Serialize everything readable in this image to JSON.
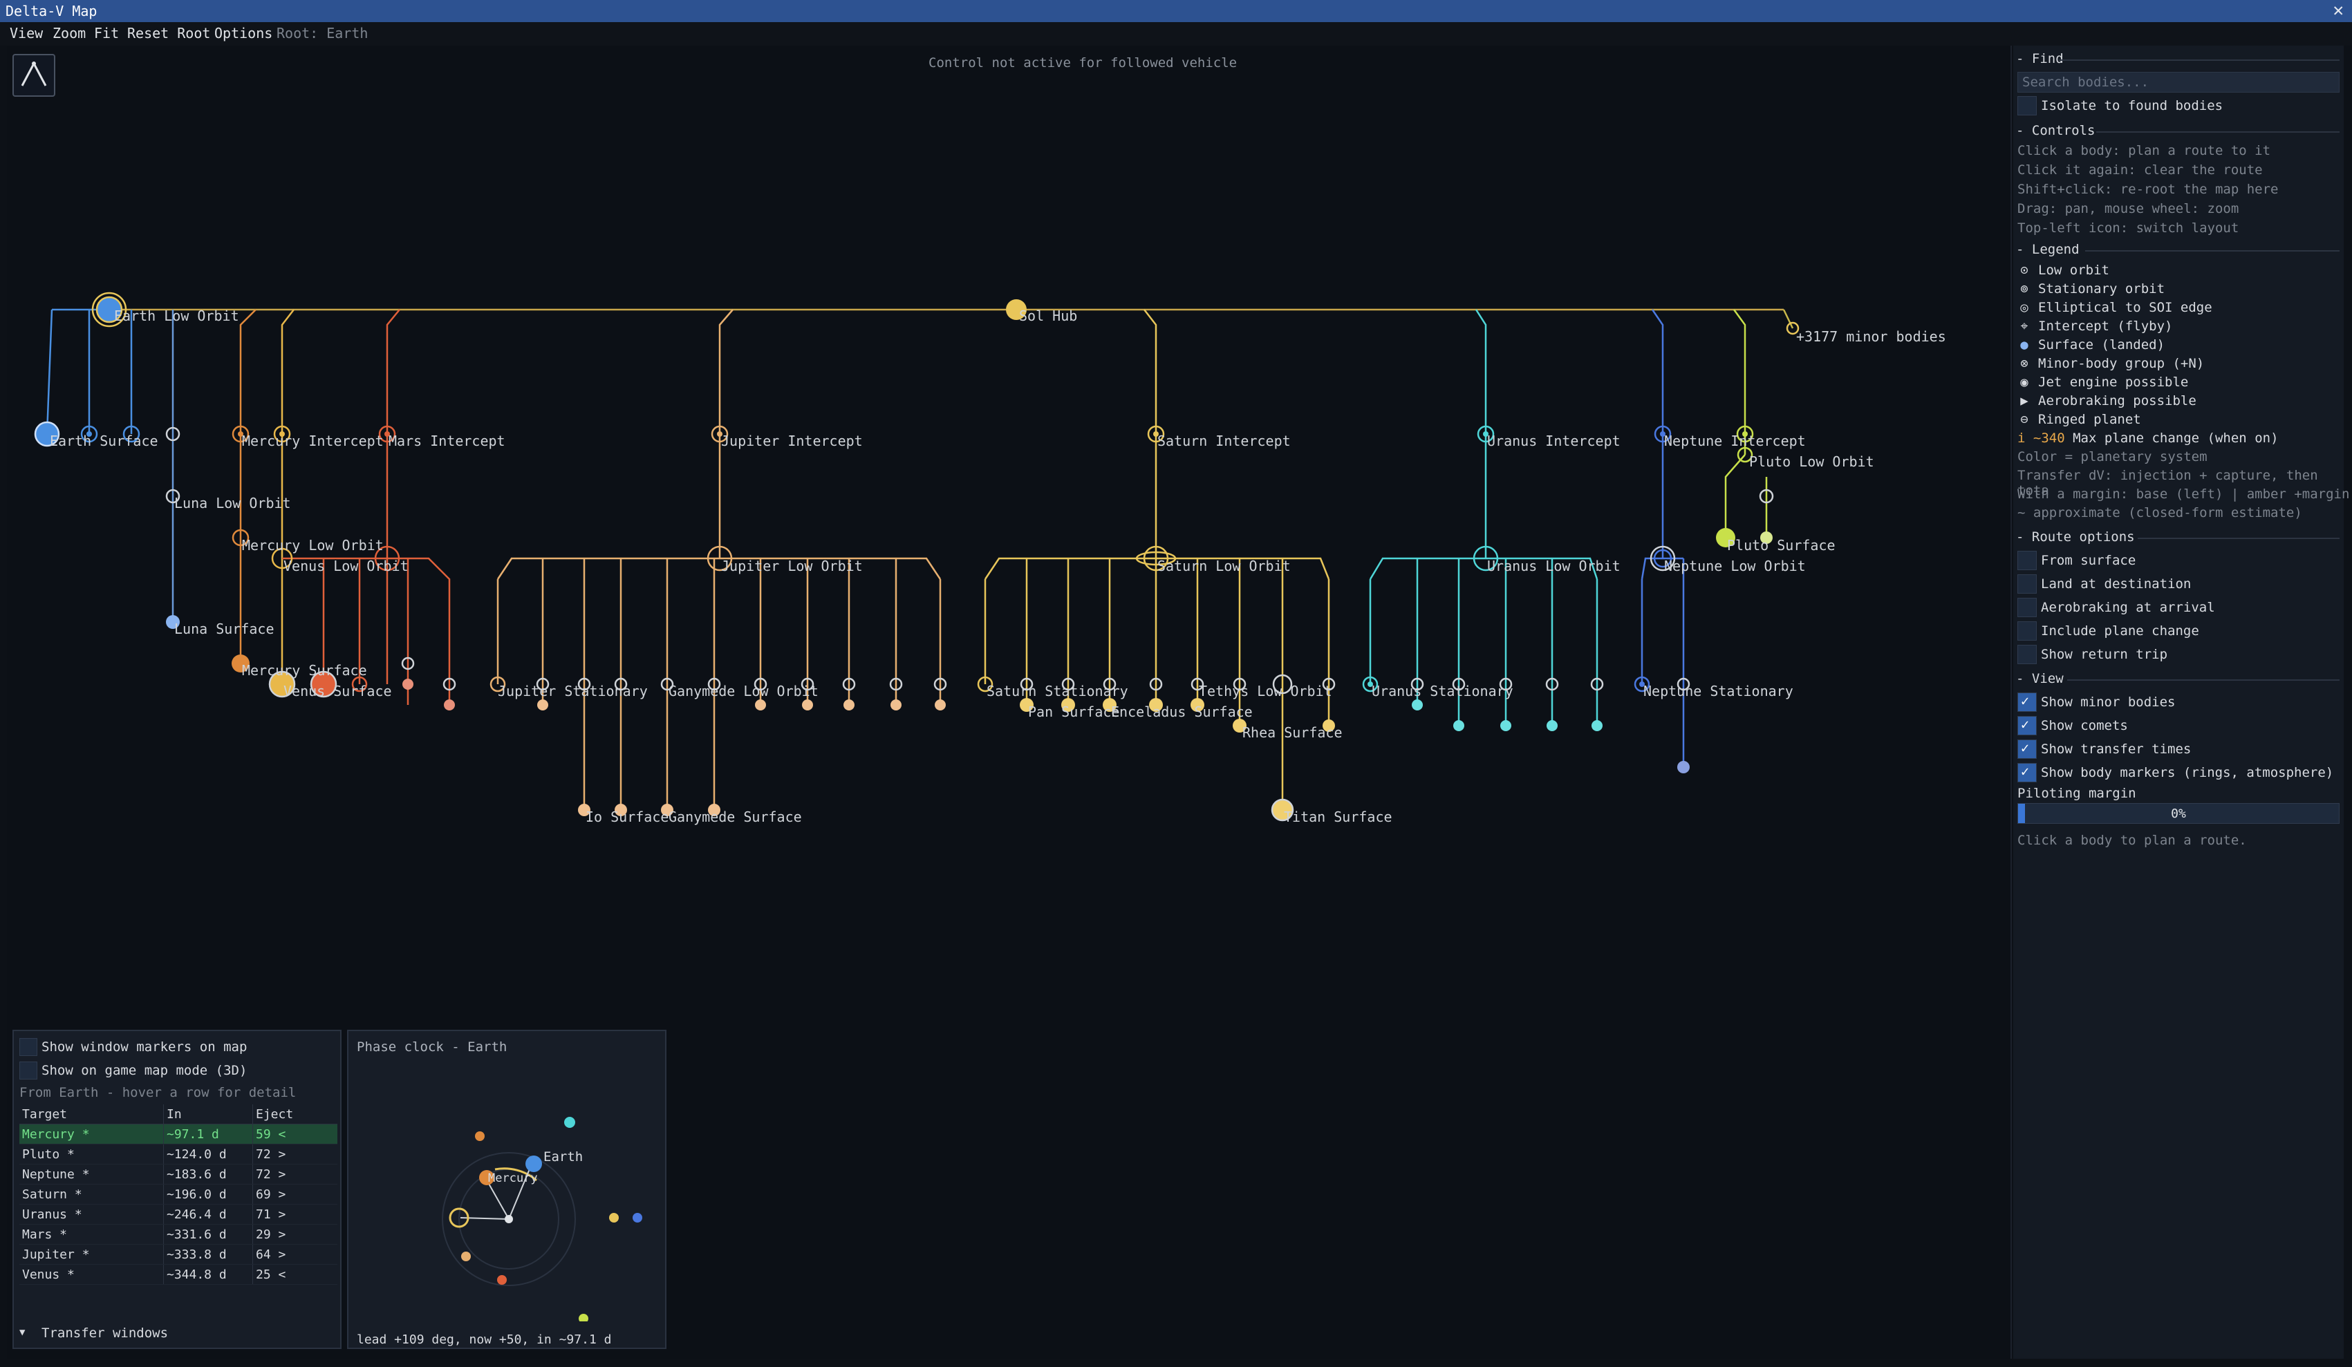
{
  "window": {
    "title": "Delta-V Map",
    "close_glyph": "✕"
  },
  "menu": {
    "items": [
      "View",
      "Zoom",
      "Fit",
      "Reset Root",
      "Options"
    ],
    "root_label": "Root: Earth"
  },
  "map": {
    "status_text": "Control not active for followed vehicle",
    "labels": {
      "earth_low_orbit": "Earth Low Orbit",
      "sol_hub": "Sol Hub",
      "minor_bodies": "+3177 minor bodies",
      "earth_surface": "Earth Surface",
      "mercury_intercept": "Mercury Intercept",
      "mars_intercept": "Mars Intercept",
      "jupiter_intercept": "Jupiter Intercept",
      "saturn_intercept": "Saturn Intercept",
      "uranus_intercept": "Uranus Intercept",
      "neptune_intercept": "Neptune Intercept",
      "pluto_low_orbit": "Pluto Low Orbit",
      "luna_low_orbit": "Luna Low Orbit",
      "mercury_low_orbit": "Mercury Low Orbit",
      "venus_low_orbit": "Venus Low Orbit",
      "jupiter_low_orbit": "Jupiter Low Orbit",
      "saturn_low_orbit": "Saturn Low Orbit",
      "uranus_low_orbit": "Uranus Low Orbit",
      "neptune_low_orbit": "Neptune Low Orbit",
      "pluto_surface": "Pluto Surface",
      "luna_surface": "Luna Surface",
      "mercury_surface": "Mercury Surface",
      "venus_surface": "Venus Surface",
      "jupiter_stationary": "Jupiter Stationary",
      "ganymede_low_orbit": "Ganymede Low Orbit",
      "saturn_stationary": "Saturn Stationary",
      "tethys_low_orbit": "Tethys Low Orbit",
      "uranus_stationary": "Uranus Stationary",
      "neptune_stationary": "Neptune Stationary",
      "pan_surface": "Pan Surface",
      "enceladus_surface": "Enceladus Surface",
      "rhea_surface": "Rhea Surface",
      "io_surface": "Io Surface",
      "ganymede_surface": "Ganymede Surface",
      "titan_surface": "Titan Surface"
    },
    "colors": {
      "earth": "#4a90e2",
      "mercury": "#e08a3c",
      "venus": "#e8b84a",
      "mars": "#e0603a",
      "jupiter": "#e8b070",
      "saturn": "#e8c65a",
      "uranus": "#4fd6d8",
      "neptune": "#4a78e0",
      "pluto": "#c8e04a",
      "sol": "#f2c94c",
      "luna": "#8ab4f0"
    }
  },
  "find": {
    "section": "Find",
    "search_placeholder": "Search bodies...",
    "isolate_label": "Isolate to found bodies"
  },
  "controls": {
    "section": "Controls",
    "hints": [
      "Click a body: plan a route to it",
      "Click it again: clear the route",
      "Shift+click: re-root the map here",
      "Drag: pan,  mouse wheel: zoom",
      "Top-left icon: switch layout"
    ]
  },
  "legend": {
    "section": "Legend",
    "items": [
      {
        "icon": "⊙",
        "label": "Low orbit"
      },
      {
        "icon": "⊚",
        "label": "Stationary orbit"
      },
      {
        "icon": "◎",
        "label": "Elliptical to SOI edge"
      },
      {
        "icon": "⌖",
        "label": "Intercept (flyby)"
      },
      {
        "icon": "●",
        "label": "Surface (landed)"
      },
      {
        "icon": "⊗",
        "label": "Minor-body group (+N)"
      },
      {
        "icon": "◉",
        "label": "Jet engine possible"
      },
      {
        "icon": "▶",
        "label": "Aerobraking possible"
      },
      {
        "icon": "⊖",
        "label": "Ringed planet"
      }
    ],
    "plane_change_prefix": "i ~340",
    "plane_change_label": "Max plane change (when on)",
    "notes": [
      "Color = planetary system",
      "Transfer dV: injection + capture, then tota",
      "With a margin: base (left) | amber +margin",
      "~  approximate (closed-form estimate)"
    ]
  },
  "route_options": {
    "section": "Route options",
    "items": [
      {
        "label": "From surface",
        "checked": false
      },
      {
        "label": "Land at destination",
        "checked": false
      },
      {
        "label": "Aerobraking at arrival",
        "checked": false
      },
      {
        "label": "Include plane change",
        "checked": false
      },
      {
        "label": "Show return trip",
        "checked": false
      }
    ]
  },
  "view": {
    "section": "View",
    "items": [
      {
        "label": "Show minor bodies",
        "checked": true
      },
      {
        "label": "Show comets",
        "checked": true
      },
      {
        "label": "Show transfer times",
        "checked": true
      },
      {
        "label": "Show body markers (rings, atmosphere)",
        "checked": true
      }
    ]
  },
  "piloting_margin": {
    "label": "Piloting margin",
    "value_text": "0%",
    "value": 0
  },
  "footer_hint": "Click a body to plan a route.",
  "transfer_windows": {
    "show_markers_label": "Show window markers on map",
    "show_game_map_label": "Show on game map mode (3D)",
    "from_hint": "From Earth - hover a row for detail",
    "columns": [
      "Target",
      "In",
      "Eject"
    ],
    "rows": [
      {
        "target": "Mercury *",
        "in": "~97.1 d",
        "eject": "59 <"
      },
      {
        "target": "Pluto *",
        "in": "~124.0 d",
        "eject": "72 >"
      },
      {
        "target": "Neptune *",
        "in": "~183.6 d",
        "eject": "72 >"
      },
      {
        "target": "Saturn *",
        "in": "~196.0 d",
        "eject": "69 >"
      },
      {
        "target": "Uranus *",
        "in": "~246.4 d",
        "eject": "71 >"
      },
      {
        "target": "Mars *",
        "in": "~331.6 d",
        "eject": "29 >"
      },
      {
        "target": "Jupiter *",
        "in": "~333.8 d",
        "eject": "64 >"
      },
      {
        "target": "Venus *",
        "in": "~344.8 d",
        "eject": "25 <"
      }
    ],
    "collapse_glyph": "▼",
    "title": "Transfer windows"
  },
  "phase_clock": {
    "title": "Phase clock - Earth",
    "earth_label": "Earth",
    "mercury_label": "Mercury",
    "footer": "lead +109 deg, now +50, in ~97.1 d"
  }
}
